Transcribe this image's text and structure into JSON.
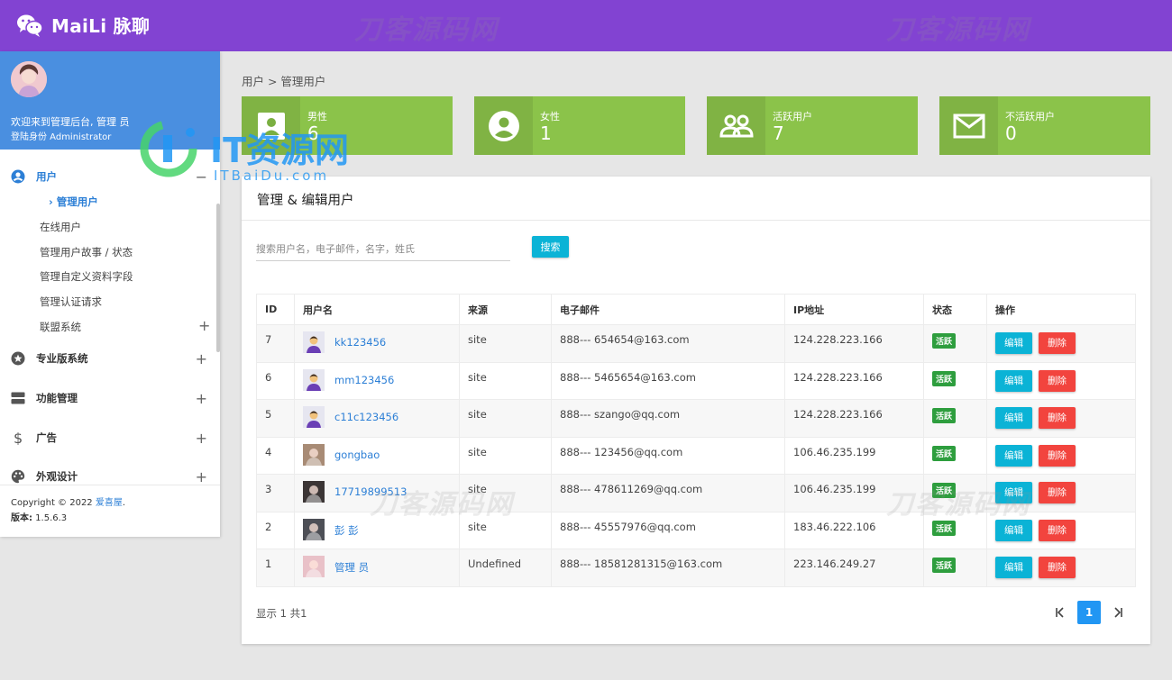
{
  "app": {
    "title": "MaiLi 脉聊"
  },
  "sidebar": {
    "welcome": "欢迎来到管理后台, 管理 员",
    "role": "登陆身份 Administrator",
    "menu": [
      {
        "label": "用户",
        "toggle": "−"
      },
      {
        "label": "专业版系统",
        "toggle": "+"
      },
      {
        "label": "功能管理",
        "toggle": "+"
      },
      {
        "label": "广告",
        "toggle": "+"
      },
      {
        "label": "外观设计",
        "toggle": "+"
      }
    ],
    "submenu": [
      {
        "label": "管理用户"
      },
      {
        "label": "在线用户"
      },
      {
        "label": "管理用户故事 / 状态"
      },
      {
        "label": "管理自定义资料字段"
      },
      {
        "label": "管理认证请求"
      },
      {
        "label": "联盟系统",
        "toggle": "+"
      }
    ],
    "footer": {
      "copyright": "Copyright © 2022 ",
      "brand": "爱喜屋",
      "dot": ".",
      "version_label": "版本:",
      "version": " 1.5.6.3"
    }
  },
  "breadcrumb": "用户 > 管理用户",
  "stats": [
    {
      "label": "男性",
      "value": "6",
      "icon": "contact-card-icon"
    },
    {
      "label": "女性",
      "value": "1",
      "icon": "account-circle-icon"
    },
    {
      "label": "活跃用户",
      "value": "7",
      "icon": "group-icon"
    },
    {
      "label": "不活跃用户",
      "value": "0",
      "icon": "mail-icon"
    }
  ],
  "panel": {
    "title": "管理 & 编辑用户",
    "search_placeholder": "搜索用户名，电子邮件，名字，姓氏",
    "search_button": "搜索",
    "columns": [
      "ID",
      "用户名",
      "来源",
      "电子邮件",
      "IP地址",
      "状态",
      "操作"
    ],
    "rows": [
      {
        "id": "7",
        "username": "kk123456",
        "source": "site",
        "email": "888--- 654654@163.com",
        "ip": "124.228.223.166",
        "status": "活跃"
      },
      {
        "id": "6",
        "username": "mm123456",
        "source": "site",
        "email": "888--- 5465654@163.com",
        "ip": "124.228.223.166",
        "status": "活跃"
      },
      {
        "id": "5",
        "username": "c11c123456",
        "source": "site",
        "email": "888--- szango@qq.com",
        "ip": "124.228.223.166",
        "status": "活跃"
      },
      {
        "id": "4",
        "username": "gongbao",
        "source": "site",
        "email": "888--- 123456@qq.com",
        "ip": "106.46.235.199",
        "status": "活跃"
      },
      {
        "id": "3",
        "username": "17719899513",
        "source": "site",
        "email": "888--- 478611269@qq.com",
        "ip": "106.46.235.199",
        "status": "活跃"
      },
      {
        "id": "2",
        "username": "彭 彭",
        "source": "site",
        "email": "888--- 45557976@qq.com",
        "ip": "183.46.222.106",
        "status": "活跃"
      },
      {
        "id": "1",
        "username": "管理 员",
        "source": "Undefined",
        "email": "888--- 18581281315@163.com",
        "ip": "223.146.249.27",
        "status": "活跃"
      }
    ],
    "edit_label": "编辑",
    "delete_label": "删除",
    "show_info": "显示 1 共1",
    "pager": {
      "first": "|<",
      "current": "1",
      "last": ">|"
    }
  },
  "watermarks": {
    "brand": "刀客源码网",
    "it_title": "IT资源网",
    "it_url": "ITBaiDu.com"
  },
  "colors": {
    "topbar": "#8243d2",
    "profile": "#4a8fe0",
    "stat_card": "#8bc34a",
    "edit": "#0bb3d6",
    "delete": "#f2443e",
    "badge": "#2e9e3e",
    "page_current": "#2196f3"
  }
}
